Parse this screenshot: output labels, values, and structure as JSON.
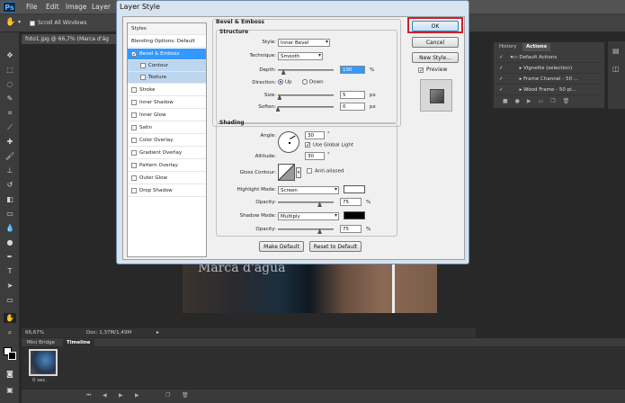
{
  "app": {
    "logo": "Ps",
    "menus": [
      "File",
      "Edit",
      "Image",
      "Layer"
    ]
  },
  "options_bar": {
    "scroll_all_windows": "Scroll All Windows"
  },
  "document": {
    "tab_title": "foto1.jpg @ 66,7% (Marca d'ág",
    "watermark_text": "Marca d'agua",
    "zoom": "66,67%",
    "doc_info": "Doc: 1,37M/1,49M"
  },
  "timeline": {
    "tabs": [
      "Mini Bridge",
      "Timeline"
    ],
    "frame_delay": "0 sec."
  },
  "actions_panel": {
    "tabs": [
      "History",
      "Actions"
    ],
    "items": [
      "Default Actions",
      "Vignette (selection)",
      "Frame Channel - 50 ...",
      "Wood Frame - 50 pi..."
    ]
  },
  "dialog": {
    "title": "Layer Style",
    "styles_header": "Styles",
    "blending_options": "Blending Options: Default",
    "style_items": [
      {
        "label": "Bevel & Emboss",
        "checked": true
      },
      {
        "label": "Contour",
        "checked": false
      },
      {
        "label": "Texture",
        "checked": false
      },
      {
        "label": "Stroke",
        "checked": false
      },
      {
        "label": "Inner Shadow",
        "checked": false
      },
      {
        "label": "Inner Glow",
        "checked": false
      },
      {
        "label": "Satin",
        "checked": false
      },
      {
        "label": "Color Overlay",
        "checked": false
      },
      {
        "label": "Gradient Overlay",
        "checked": false
      },
      {
        "label": "Pattern Overlay",
        "checked": false
      },
      {
        "label": "Outer Glow",
        "checked": false
      },
      {
        "label": "Drop Shadow",
        "checked": false
      }
    ],
    "bevel": {
      "section": "Bevel & Emboss",
      "structure": "Structure",
      "style_label": "Style:",
      "style_value": "Inner Bevel",
      "technique_label": "Technique:",
      "technique_value": "Smooth",
      "depth_label": "Depth:",
      "depth_value": "100",
      "depth_fraction": 0.1,
      "direction_label": "Direction:",
      "direction_up": "Up",
      "direction_down": "Down",
      "size_label": "Size:",
      "size_value": "5",
      "size_fraction": 0.03,
      "soften_label": "Soften:",
      "soften_value": "0",
      "soften_fraction": 0.0,
      "unit_pct": "%",
      "unit_px": "px"
    },
    "shading": {
      "section": "Shading",
      "angle_label": "Angle:",
      "angle_value": "30",
      "unit_deg": "°",
      "global_light": "Use Global Light",
      "altitude_label": "Altitude:",
      "altitude_value": "30",
      "gloss_label": "Gloss Contour:",
      "anti_aliased": "Anti-aliased",
      "highlight_label": "Highlight Mode:",
      "highlight_value": "Screen",
      "opacity_label": "Opacity:",
      "highlight_opacity": "75",
      "highlight_opacity_fraction": 0.75,
      "shadow_label": "Shadow Mode:",
      "shadow_value": "Multiply",
      "shadow_opacity": "75",
      "shadow_opacity_fraction": 0.75,
      "highlight_color": "#ffffff",
      "shadow_color": "#000000"
    },
    "make_default": "Make Default",
    "reset_default": "Reset to Default",
    "ok": "OK",
    "cancel": "Cancel",
    "new_style": "New Style...",
    "preview": "Preview"
  },
  "colors": {
    "ok_highlight": "#d0202a",
    "selection": "#3399ff"
  }
}
